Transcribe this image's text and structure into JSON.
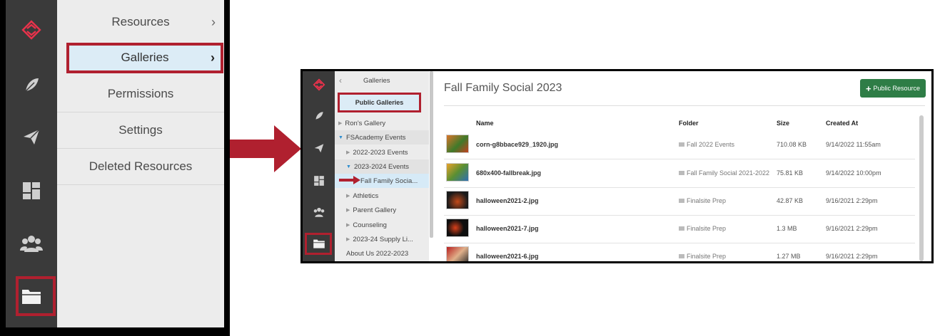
{
  "left": {
    "menu": {
      "resources": "Resources",
      "galleries": "Galleries",
      "permissions": "Permissions",
      "settings": "Settings",
      "deleted": "Deleted Resources",
      "chevron": "›"
    },
    "rail_icons": [
      "logo-icon",
      "feather-icon",
      "send-icon",
      "dashboard-icon",
      "users-icon",
      "folder-icon"
    ],
    "highlight_color": "#b0202f"
  },
  "right": {
    "tree": {
      "back": "‹",
      "header": "Galleries",
      "public": "Public Galleries",
      "items": [
        "Ron's Gallery",
        "FSAcademy Events",
        "2022-2023 Events",
        "2023-2024 Events",
        "Fall Family Socia...",
        "Athletics",
        "Parent Gallery",
        "Counseling",
        "2023-24 Supply Li...",
        "About Us 2022-2023"
      ]
    },
    "title": "Fall Family Social 2023",
    "button": {
      "plus": "+",
      "label": "Public Resource"
    },
    "columns": {
      "name": "Name",
      "folder": "Folder",
      "size": "Size",
      "created": "Created At"
    },
    "files": [
      {
        "name": "corn-g8bbace929_1920.jpg",
        "folder": "Fall 2022 Events",
        "size": "710.08 KB",
        "created": "9/14/2022 11:55am"
      },
      {
        "name": "680x400-fallbreak.jpg",
        "folder": "Fall Family Social 2021-2022",
        "size": "75.81 KB",
        "created": "9/14/2022 10:00pm"
      },
      {
        "name": "halloween2021-2.jpg",
        "folder": "Finalsite Prep",
        "size": "42.87 KB",
        "created": "9/16/2021 2:29pm"
      },
      {
        "name": "halloween2021-7.jpg",
        "folder": "Finalsite Prep",
        "size": "1.3 MB",
        "created": "9/16/2021 2:29pm"
      },
      {
        "name": "halloween2021-6.jpg",
        "folder": "Finalsite Prep",
        "size": "1.27 MB",
        "created": "9/16/2021 2:29pm"
      }
    ],
    "accent": "#2e7d46"
  }
}
